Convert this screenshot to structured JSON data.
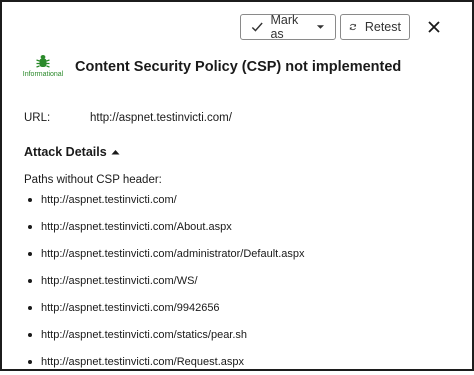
{
  "toolbar": {
    "mark_as_label": "Mark as",
    "retest_label": "Retest"
  },
  "vulnerability": {
    "severity": "Informational",
    "title": "Content Security Policy (CSP) not implemented",
    "url_label": "URL:",
    "url": "http://aspnet.testinvicti.com/"
  },
  "attack_details": {
    "heading": "Attack Details",
    "paths_title": "Paths without CSP header:",
    "paths": [
      "http://aspnet.testinvicti.com/",
      "http://aspnet.testinvicti.com/About.aspx",
      "http://aspnet.testinvicti.com/administrator/Default.aspx",
      "http://aspnet.testinvicti.com/WS/",
      "http://aspnet.testinvicti.com/9942656",
      "http://aspnet.testinvicti.com/statics/pear.sh",
      "http://aspnet.testinvicti.com/Request.aspx"
    ]
  },
  "colors": {
    "severity_green": "#2b8a2b",
    "text": "#1a1a1a"
  }
}
